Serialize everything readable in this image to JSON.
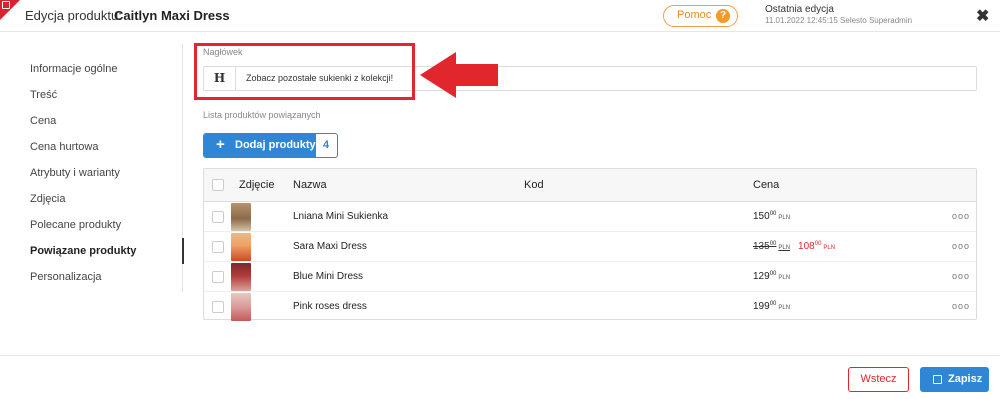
{
  "header": {
    "title_label": "Edycja produktu:",
    "product_name": "Caitlyn Maxi Dress",
    "help_label": "Pomoc",
    "help_icon": "?",
    "last_edit_label": "Ostatnia edycja",
    "last_edit_meta": "11.01.2022  12:45:15    Selesto Superadmin",
    "close_icon": "✖"
  },
  "sidebar": {
    "items": [
      {
        "label": "Informacje ogólne",
        "active": false
      },
      {
        "label": "Treść",
        "active": false
      },
      {
        "label": "Cena",
        "active": false
      },
      {
        "label": "Cena hurtowa",
        "active": false
      },
      {
        "label": "Atrybuty i warianty",
        "active": false
      },
      {
        "label": "Zdjęcia",
        "active": false
      },
      {
        "label": "Polecane produkty",
        "active": false
      },
      {
        "label": "Powiązane produkty",
        "active": true
      },
      {
        "label": "Personalizacja",
        "active": false
      }
    ]
  },
  "main": {
    "heading_section_label": "Nagłówek",
    "heading_icon": "H",
    "heading_value": "Zobacz pozostałe sukienki z kolekcji!",
    "related_list_label": "Lista produktów powiązanych",
    "add_button": {
      "plus": "+",
      "label": "Dodaj produkty",
      "count": "4"
    },
    "table": {
      "columns": {
        "photo": "Zdjęcie",
        "name": "Nazwa",
        "code": "Kod",
        "price": "Cena"
      },
      "rows": [
        {
          "name": "Lniana Mini Sukienka",
          "code": "",
          "price_main": "150",
          "price_dec": "00",
          "currency": "PLN",
          "sale": false
        },
        {
          "name": "Sara Maxi Dress",
          "code": "",
          "price_main": "135",
          "price_dec": "00",
          "currency": "PLN",
          "sale": true,
          "sale_main": "108",
          "sale_dec": "00"
        },
        {
          "name": "Blue Mini Dress",
          "code": "",
          "price_main": "129",
          "price_dec": "00",
          "currency": "PLN",
          "sale": false
        },
        {
          "name": "Pink roses dress",
          "code": "",
          "price_main": "199",
          "price_dec": "00",
          "currency": "PLN",
          "sale": false
        }
      ],
      "row_menu": "ooo"
    }
  },
  "footer": {
    "back_label": "Wstecz",
    "save_label": "Zapisz"
  },
  "colors": {
    "accent": "#2e86d4",
    "danger": "#e2262e",
    "help": "#f29b26"
  }
}
